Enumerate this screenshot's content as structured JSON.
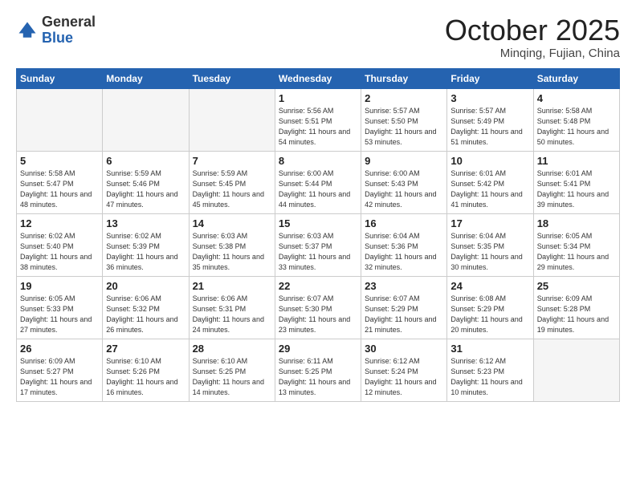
{
  "header": {
    "logo": {
      "general": "General",
      "blue": "Blue"
    },
    "title": "October 2025",
    "location": "Minqing, Fujian, China"
  },
  "weekdays": [
    "Sunday",
    "Monday",
    "Tuesday",
    "Wednesday",
    "Thursday",
    "Friday",
    "Saturday"
  ],
  "weeks": [
    [
      {
        "day": "",
        "sunrise": "",
        "sunset": "",
        "daylight": "",
        "empty": true
      },
      {
        "day": "",
        "sunrise": "",
        "sunset": "",
        "daylight": "",
        "empty": true
      },
      {
        "day": "",
        "sunrise": "",
        "sunset": "",
        "daylight": "",
        "empty": true
      },
      {
        "day": "1",
        "sunrise": "Sunrise: 5:56 AM",
        "sunset": "Sunset: 5:51 PM",
        "daylight": "Daylight: 11 hours and 54 minutes."
      },
      {
        "day": "2",
        "sunrise": "Sunrise: 5:57 AM",
        "sunset": "Sunset: 5:50 PM",
        "daylight": "Daylight: 11 hours and 53 minutes."
      },
      {
        "day": "3",
        "sunrise": "Sunrise: 5:57 AM",
        "sunset": "Sunset: 5:49 PM",
        "daylight": "Daylight: 11 hours and 51 minutes."
      },
      {
        "day": "4",
        "sunrise": "Sunrise: 5:58 AM",
        "sunset": "Sunset: 5:48 PM",
        "daylight": "Daylight: 11 hours and 50 minutes."
      }
    ],
    [
      {
        "day": "5",
        "sunrise": "Sunrise: 5:58 AM",
        "sunset": "Sunset: 5:47 PM",
        "daylight": "Daylight: 11 hours and 48 minutes."
      },
      {
        "day": "6",
        "sunrise": "Sunrise: 5:59 AM",
        "sunset": "Sunset: 5:46 PM",
        "daylight": "Daylight: 11 hours and 47 minutes."
      },
      {
        "day": "7",
        "sunrise": "Sunrise: 5:59 AM",
        "sunset": "Sunset: 5:45 PM",
        "daylight": "Daylight: 11 hours and 45 minutes."
      },
      {
        "day": "8",
        "sunrise": "Sunrise: 6:00 AM",
        "sunset": "Sunset: 5:44 PM",
        "daylight": "Daylight: 11 hours and 44 minutes."
      },
      {
        "day": "9",
        "sunrise": "Sunrise: 6:00 AM",
        "sunset": "Sunset: 5:43 PM",
        "daylight": "Daylight: 11 hours and 42 minutes."
      },
      {
        "day": "10",
        "sunrise": "Sunrise: 6:01 AM",
        "sunset": "Sunset: 5:42 PM",
        "daylight": "Daylight: 11 hours and 41 minutes."
      },
      {
        "day": "11",
        "sunrise": "Sunrise: 6:01 AM",
        "sunset": "Sunset: 5:41 PM",
        "daylight": "Daylight: 11 hours and 39 minutes."
      }
    ],
    [
      {
        "day": "12",
        "sunrise": "Sunrise: 6:02 AM",
        "sunset": "Sunset: 5:40 PM",
        "daylight": "Daylight: 11 hours and 38 minutes."
      },
      {
        "day": "13",
        "sunrise": "Sunrise: 6:02 AM",
        "sunset": "Sunset: 5:39 PM",
        "daylight": "Daylight: 11 hours and 36 minutes."
      },
      {
        "day": "14",
        "sunrise": "Sunrise: 6:03 AM",
        "sunset": "Sunset: 5:38 PM",
        "daylight": "Daylight: 11 hours and 35 minutes."
      },
      {
        "day": "15",
        "sunrise": "Sunrise: 6:03 AM",
        "sunset": "Sunset: 5:37 PM",
        "daylight": "Daylight: 11 hours and 33 minutes."
      },
      {
        "day": "16",
        "sunrise": "Sunrise: 6:04 AM",
        "sunset": "Sunset: 5:36 PM",
        "daylight": "Daylight: 11 hours and 32 minutes."
      },
      {
        "day": "17",
        "sunrise": "Sunrise: 6:04 AM",
        "sunset": "Sunset: 5:35 PM",
        "daylight": "Daylight: 11 hours and 30 minutes."
      },
      {
        "day": "18",
        "sunrise": "Sunrise: 6:05 AM",
        "sunset": "Sunset: 5:34 PM",
        "daylight": "Daylight: 11 hours and 29 minutes."
      }
    ],
    [
      {
        "day": "19",
        "sunrise": "Sunrise: 6:05 AM",
        "sunset": "Sunset: 5:33 PM",
        "daylight": "Daylight: 11 hours and 27 minutes."
      },
      {
        "day": "20",
        "sunrise": "Sunrise: 6:06 AM",
        "sunset": "Sunset: 5:32 PM",
        "daylight": "Daylight: 11 hours and 26 minutes."
      },
      {
        "day": "21",
        "sunrise": "Sunrise: 6:06 AM",
        "sunset": "Sunset: 5:31 PM",
        "daylight": "Daylight: 11 hours and 24 minutes."
      },
      {
        "day": "22",
        "sunrise": "Sunrise: 6:07 AM",
        "sunset": "Sunset: 5:30 PM",
        "daylight": "Daylight: 11 hours and 23 minutes."
      },
      {
        "day": "23",
        "sunrise": "Sunrise: 6:07 AM",
        "sunset": "Sunset: 5:29 PM",
        "daylight": "Daylight: 11 hours and 21 minutes."
      },
      {
        "day": "24",
        "sunrise": "Sunrise: 6:08 AM",
        "sunset": "Sunset: 5:29 PM",
        "daylight": "Daylight: 11 hours and 20 minutes."
      },
      {
        "day": "25",
        "sunrise": "Sunrise: 6:09 AM",
        "sunset": "Sunset: 5:28 PM",
        "daylight": "Daylight: 11 hours and 19 minutes."
      }
    ],
    [
      {
        "day": "26",
        "sunrise": "Sunrise: 6:09 AM",
        "sunset": "Sunset: 5:27 PM",
        "daylight": "Daylight: 11 hours and 17 minutes."
      },
      {
        "day": "27",
        "sunrise": "Sunrise: 6:10 AM",
        "sunset": "Sunset: 5:26 PM",
        "daylight": "Daylight: 11 hours and 16 minutes."
      },
      {
        "day": "28",
        "sunrise": "Sunrise: 6:10 AM",
        "sunset": "Sunset: 5:25 PM",
        "daylight": "Daylight: 11 hours and 14 minutes."
      },
      {
        "day": "29",
        "sunrise": "Sunrise: 6:11 AM",
        "sunset": "Sunset: 5:25 PM",
        "daylight": "Daylight: 11 hours and 13 minutes."
      },
      {
        "day": "30",
        "sunrise": "Sunrise: 6:12 AM",
        "sunset": "Sunset: 5:24 PM",
        "daylight": "Daylight: 11 hours and 12 minutes."
      },
      {
        "day": "31",
        "sunrise": "Sunrise: 6:12 AM",
        "sunset": "Sunset: 5:23 PM",
        "daylight": "Daylight: 11 hours and 10 minutes."
      },
      {
        "day": "",
        "sunrise": "",
        "sunset": "",
        "daylight": "",
        "empty": true
      }
    ]
  ]
}
